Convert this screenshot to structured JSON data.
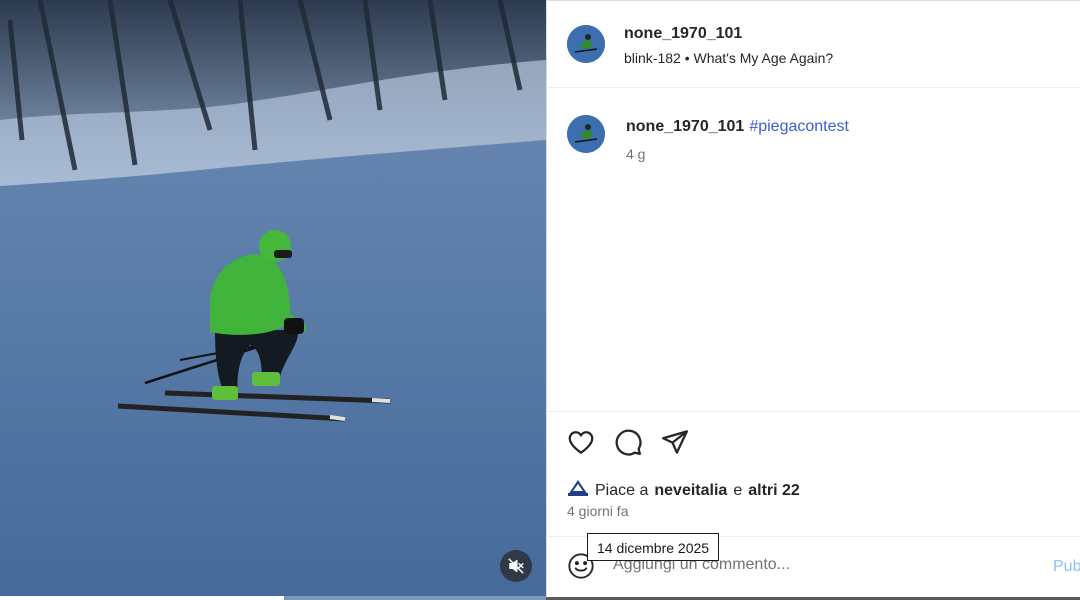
{
  "media": {
    "mute_icon": "speaker-muted-icon",
    "progress_fraction": 0.52
  },
  "header": {
    "username": "none_1970_101",
    "audio_artist": "blink-182",
    "audio_separator": "•",
    "audio_title": "What's My Age Again?"
  },
  "caption": {
    "username": "none_1970_101",
    "hashtag": "#piegacontest",
    "time": "4 g"
  },
  "actions": {
    "like_icon": "heart-icon",
    "comment_icon": "comment-bubble-icon",
    "share_icon": "paper-plane-icon"
  },
  "likes": {
    "prefix": "Piace a",
    "liker": "neveitalia",
    "connector": "e",
    "others": "altri 22"
  },
  "post_date": "4 giorni fa",
  "tooltip": "14 dicembre 2025",
  "comment": {
    "emoji_icon": "smiley-icon",
    "placeholder": "Aggiungi un commento...",
    "value": "",
    "publish_label": "Pubblica"
  },
  "colors": {
    "link": "#3f5dcf",
    "publish": "#8fc1f5",
    "muted_text": "#737373"
  }
}
